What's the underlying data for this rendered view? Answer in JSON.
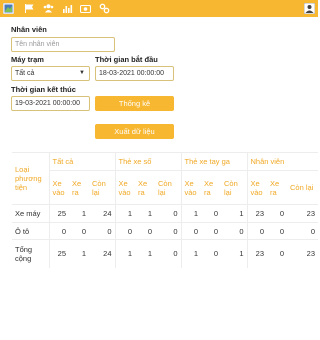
{
  "topbar": {
    "icons": [
      "app-logo-icon",
      "flag-icon",
      "users-icon",
      "bar-chart-icon",
      "camera-icon",
      "settings-icon",
      "user-icon"
    ]
  },
  "form": {
    "employee_label": "Nhân viên",
    "employee_placeholder": "Tên nhân viên",
    "station_label": "Máy trạm",
    "station_value": "Tất cả",
    "start_label": "Thời gian bắt đầu",
    "start_value": "18-03-2021 00:00:00",
    "end_label": "Thời gian kết thúc",
    "end_value": "19-03-2021 00:00:00",
    "stats_button": "Thống kê",
    "export_button": "Xuất dữ liệu"
  },
  "table": {
    "vehicle_type_header": "Loại phương tiện",
    "groups": [
      "Tất cả",
      "Thẻ xe số",
      "Thẻ xe tay ga",
      "Nhân viên"
    ],
    "sub_headers": [
      "Xe vào",
      "Xe ra",
      "Còn lại"
    ],
    "rows": [
      {
        "label": "Xe máy",
        "values": [
          "25",
          "1",
          "24",
          "1",
          "1",
          "0",
          "1",
          "0",
          "1",
          "23",
          "0",
          "23"
        ]
      },
      {
        "label": "Ô tô",
        "values": [
          "0",
          "0",
          "0",
          "0",
          "0",
          "0",
          "0",
          "0",
          "0",
          "0",
          "0",
          "0"
        ]
      },
      {
        "label": "Tổng cộng",
        "values": [
          "25",
          "1",
          "24",
          "1",
          "1",
          "0",
          "1",
          "0",
          "1",
          "23",
          "0",
          "23"
        ]
      }
    ]
  }
}
